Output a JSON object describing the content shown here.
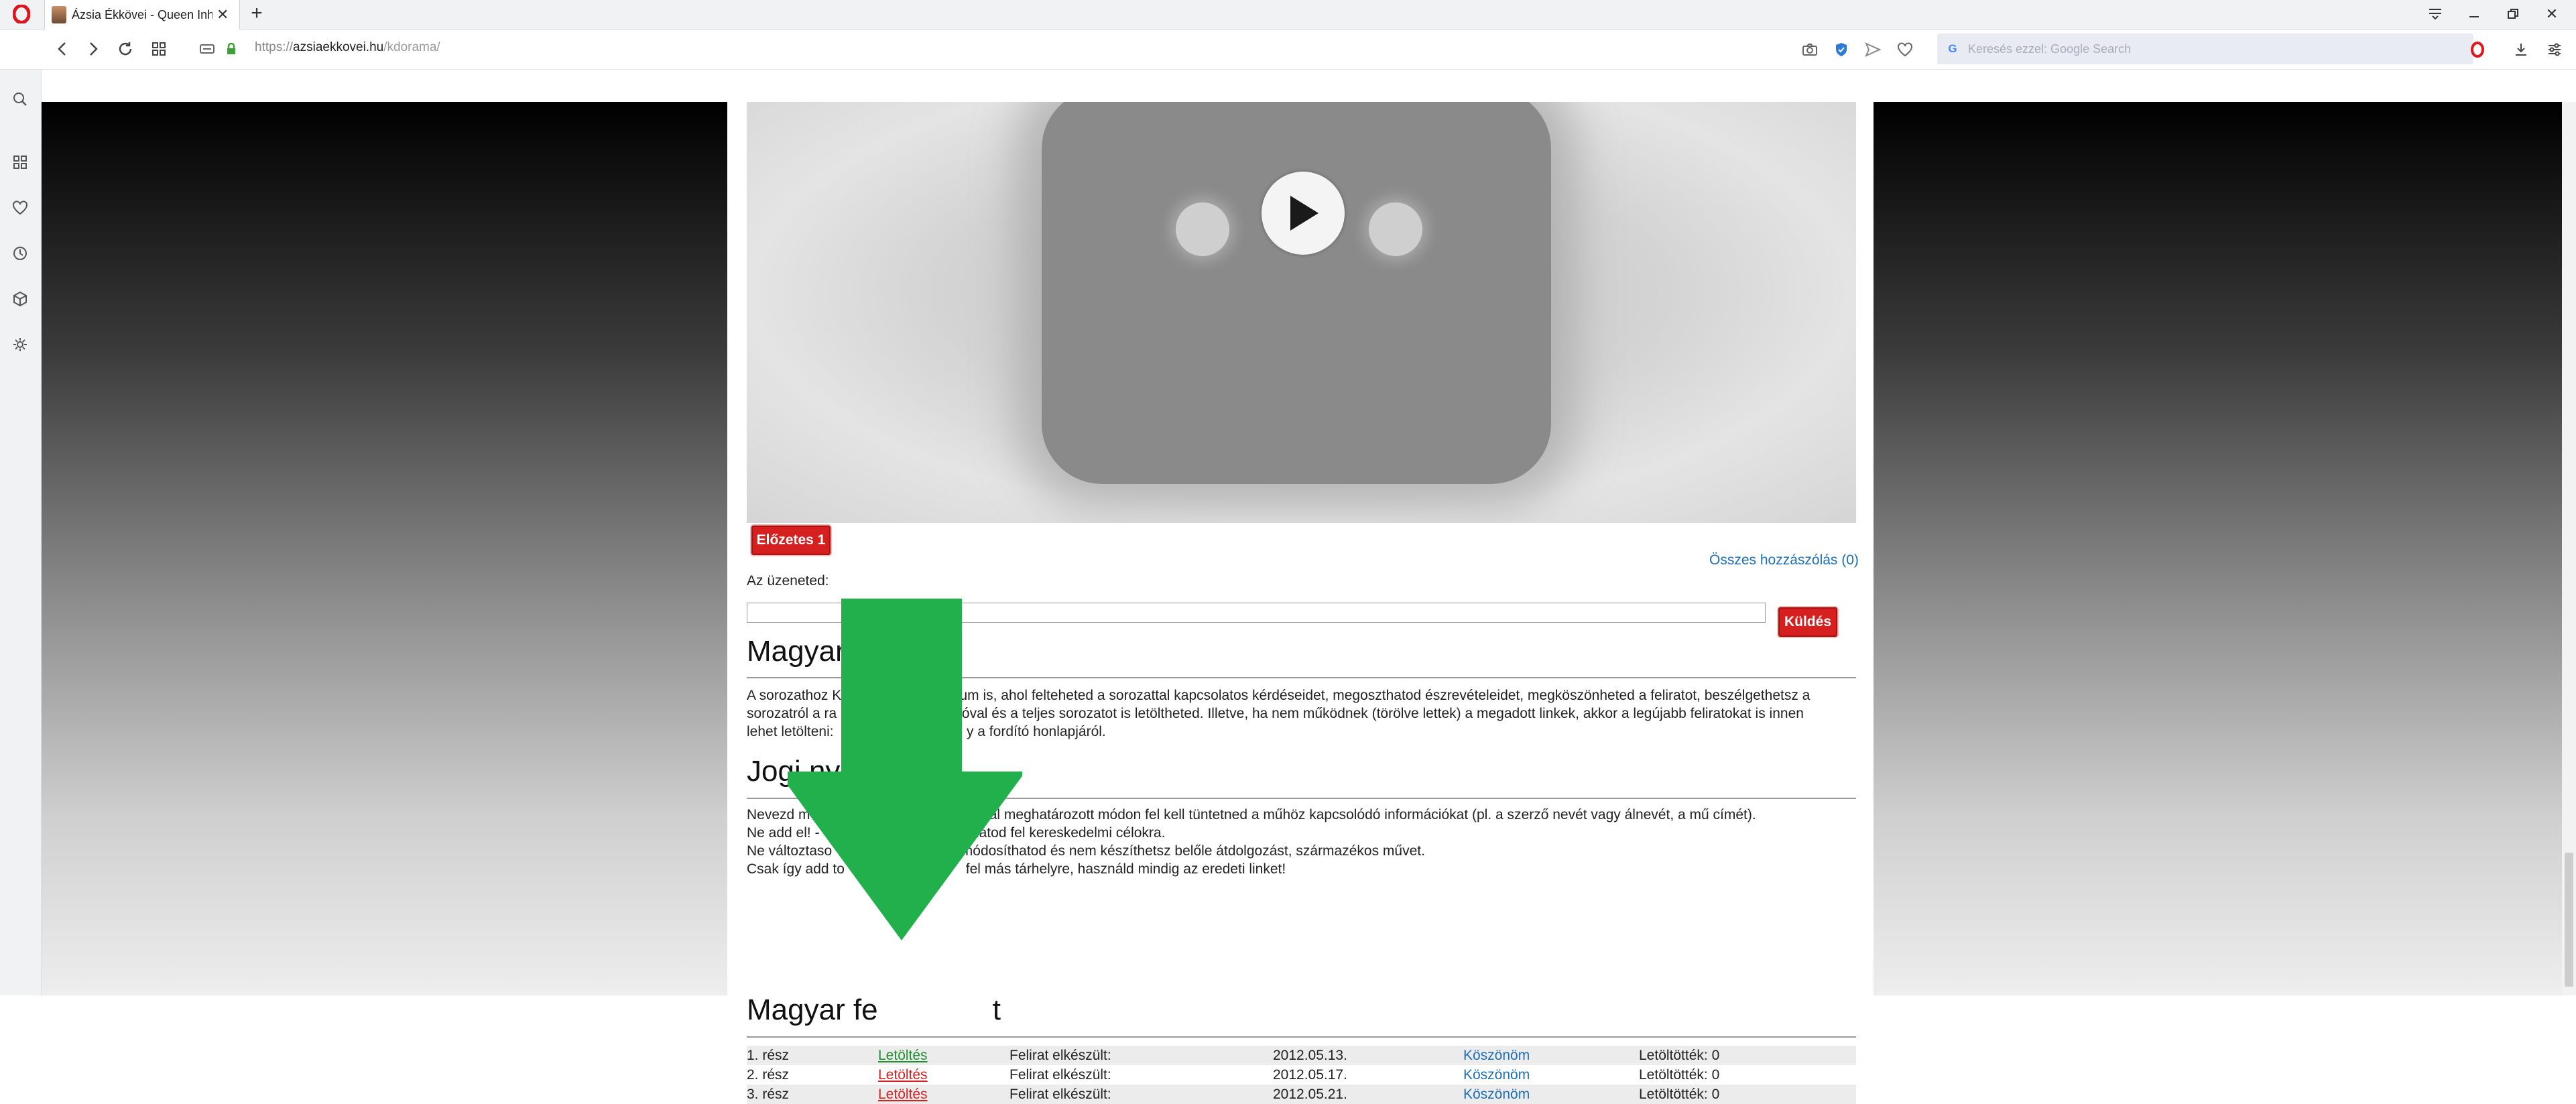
{
  "browser": {
    "tab_title": "Ázsia Ékkövei - Queen Inhy",
    "url_scheme": "https://",
    "url_host": "azsiaekkovei.hu",
    "url_path": "/kdorama/",
    "search_placeholder": "Keresés ezzel: Google Search"
  },
  "page": {
    "preview_button": "Előzetes 1",
    "all_comments_link": "Összes hozzászólás (0)",
    "message_label": "Az üzeneted:",
    "send_button": "Küldés",
    "section1": {
      "title": "Magyar",
      "text_line1": "A sorozathoz K                             rum is, ahol felteheted a sorozattal kapcsolatos kérdéseidet, megoszthatod észrevételeidet, megköszönheted a feliratot, beszélgethetsz a",
      "text_line2": "sorozatról a ra                                óval és a teljes sorozatot is letöltheted. Illetve, ha nem működnek (törölve lettek) a megadott linkek, akkor a legújabb feliratokat is innen",
      "text_line3": "lehet letölteni:                                  y a fordító honlapjáról."
    },
    "section2": {
      "title": "Jogi nyi",
      "line1": "Nevezd m                                        t által meghatározott módon fel kell tüntetned a műhöz kapcsolódó információkat (pl. a szerző nevét vagy álnevét, a mű címét).",
      "line2": "Ne add el! -                                    alhatod fel kereskedelmi célokra.",
      "line3": "Ne változtaso                                 módosíthatod és nem készíthetsz belőle átdolgozást, származékos művet.",
      "line4": "Csak így add to                               fel más tárhelyre, használd mindig az eredeti linket!"
    },
    "section3": {
      "title": "Magyar fe              t"
    },
    "subtitle_rows": [
      {
        "episode": "1. rész",
        "download": "Letöltés",
        "label": "Felirat elkészült:",
        "date": "2012.05.13.",
        "thanks": "Köszönöm",
        "count": "Letöltötték: 0"
      },
      {
        "episode": "2. rész",
        "download": "Letöltés",
        "label": "Felirat elkészült:",
        "date": "2012.05.17.",
        "thanks": "Köszönöm",
        "count": "Letöltötték: 0"
      },
      {
        "episode": "3. rész",
        "download": "Letöltés",
        "label": "Felirat elkészült:",
        "date": "2012.05.21.",
        "thanks": "Köszönöm",
        "count": "Letöltötték: 0"
      }
    ]
  },
  "colors": {
    "red_button": "#d62020",
    "link_blue": "#1d6fb5",
    "arrow_green": "#21b04b"
  },
  "icons": [
    "opera-logo-icon",
    "close-icon",
    "plus-icon",
    "back-icon",
    "forward-icon",
    "reload-icon",
    "speed-dial-icon",
    "lock-icon",
    "camera-icon",
    "shield-icon",
    "send-icon",
    "heart-icon",
    "google-icon",
    "opera-icon",
    "download-icon",
    "easy-setup-icon",
    "play-icon"
  ]
}
